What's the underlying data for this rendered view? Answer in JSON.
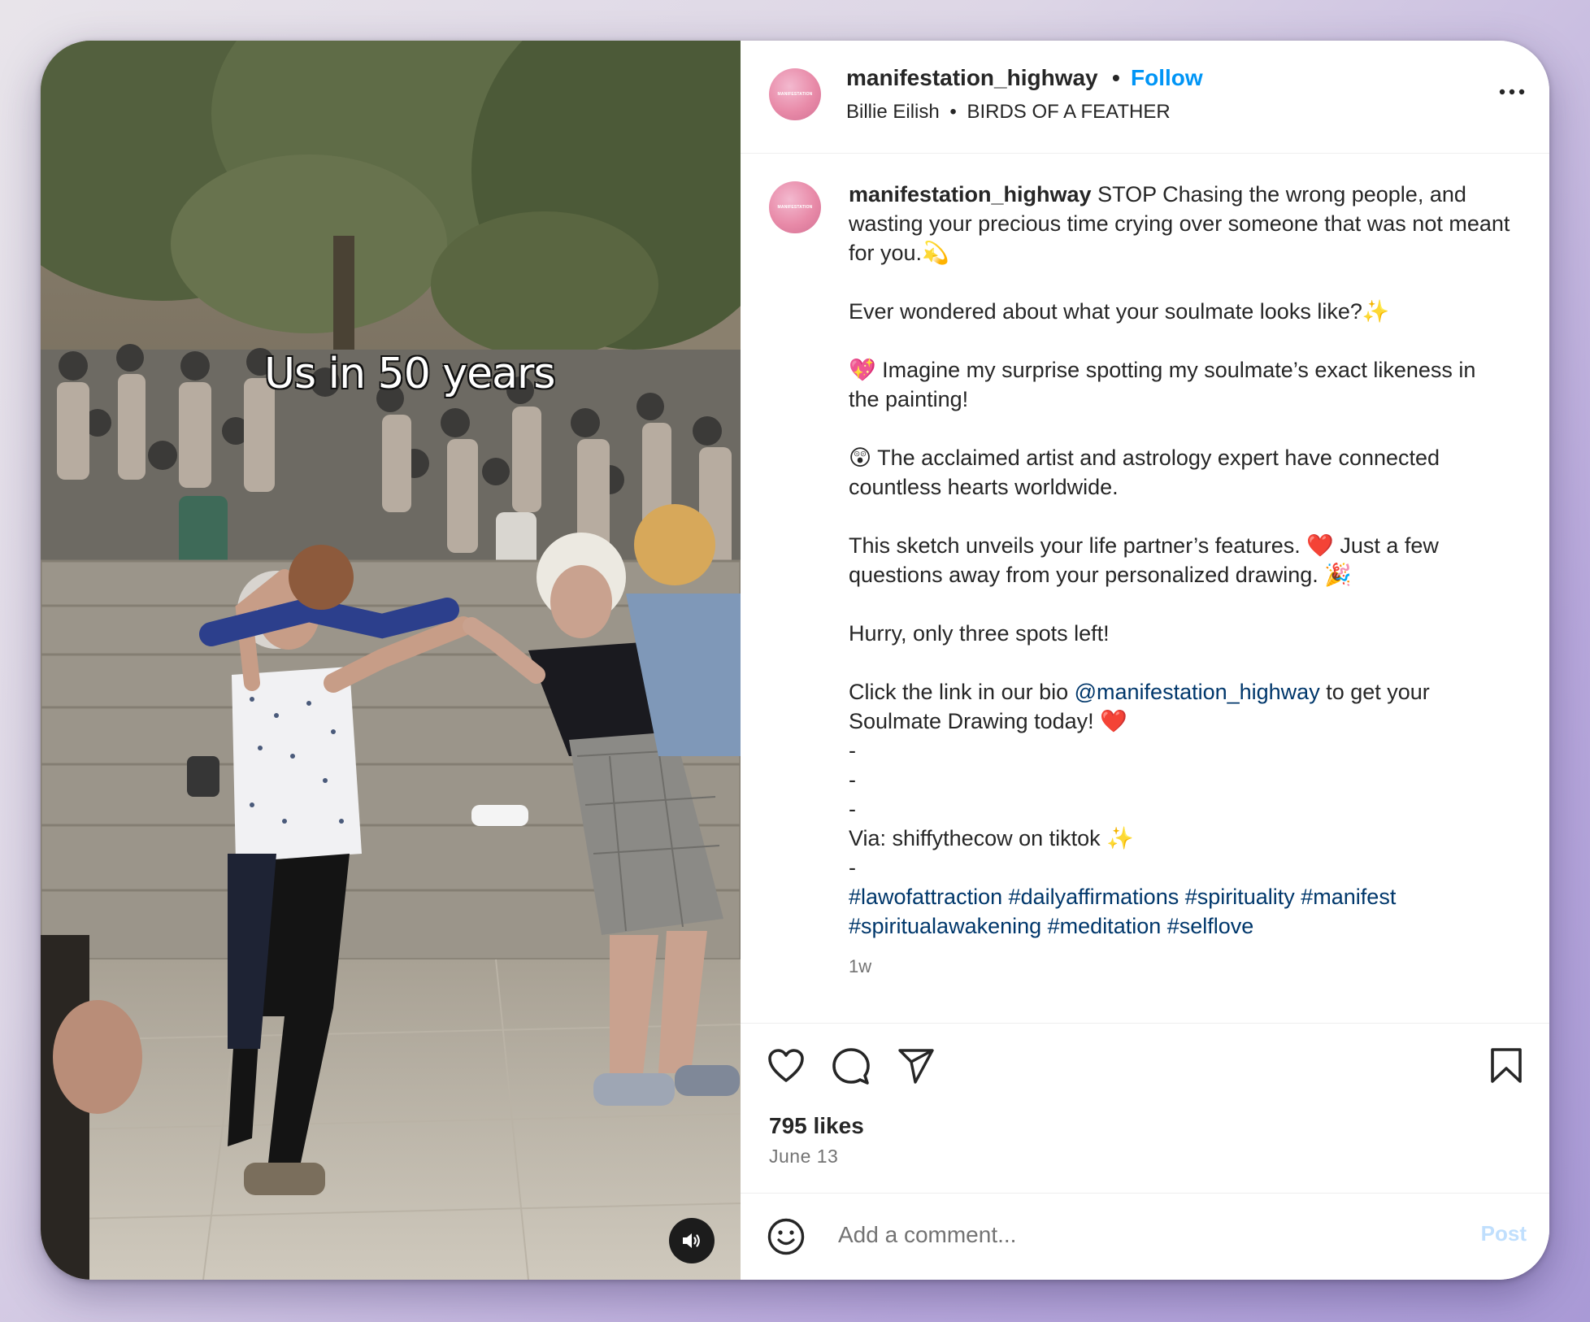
{
  "video": {
    "overlay_text": "Us in 50 years",
    "mute_icon": "speaker-icon"
  },
  "header": {
    "username": "manifestation_highway",
    "separator": "•",
    "follow_label": "Follow",
    "audio_artist": "Billie Eilish",
    "audio_separator": "•",
    "audio_track": "BIRDS OF A FEATHER",
    "avatar_text": "MANIFESTATION",
    "more_icon": "more-options-icon"
  },
  "caption": {
    "username": "manifestation_highway",
    "line1": " STOP Chasing the wrong people, and wasting your precious time crying over someone that was not meant for you.💫",
    "line2": "Ever wondered about what your soulmate looks like?✨",
    "line3": "💖 Imagine my surprise spotting my soulmate’s exact likeness in the painting!",
    "line4": "😲 The acclaimed artist and astrology expert have connected countless hearts worldwide.",
    "line5": "This sketch unveils your life partner’s features. ❤️ Just a few questions away from your personalized drawing. 🎉",
    "line6": "Hurry, only three spots left!",
    "line7_pre": "Click the link in our bio ",
    "line7_mention": "@manifestation_highway",
    "line7_post": " to get your Soulmate Drawing today! ❤️",
    "dash1": "-",
    "dash2": "-",
    "dash3": "-",
    "via": "Via: shiffythecow on tiktok ✨",
    "dash4": "-",
    "hashtags_line1": "#lawofattraction #dailyaffirmations #spirituality #manifest",
    "hashtags_line2": "#spiritualawakening #meditation #selflove",
    "timestamp": "1w"
  },
  "actions": {
    "like_icon": "heart-icon",
    "comment_icon": "comment-icon",
    "share_icon": "share-icon",
    "save_icon": "bookmark-icon",
    "likes": "795 likes",
    "date": "June 13"
  },
  "comment_box": {
    "emoji_icon": "emoji-icon",
    "placeholder": "Add a comment...",
    "post_label": "Post",
    "post_color": "#c0dffd"
  },
  "colors": {
    "accent": "#0095f6",
    "link": "#00376b",
    "text": "#262626",
    "muted": "#737373"
  }
}
